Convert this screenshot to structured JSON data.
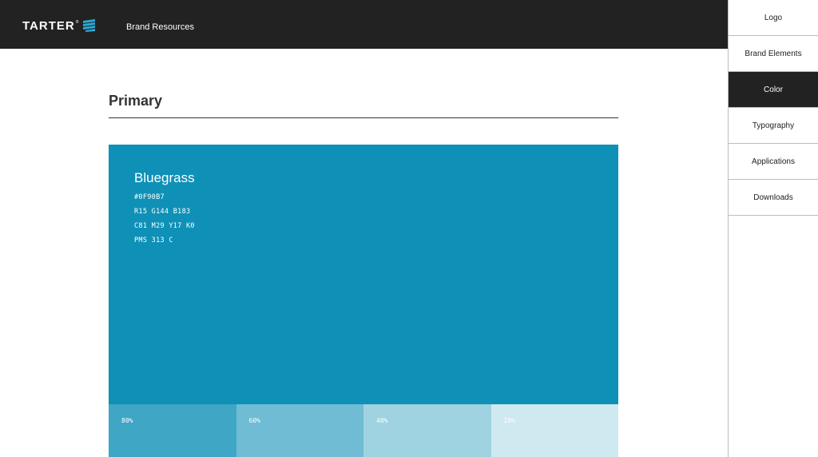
{
  "header": {
    "logo_text": "TARTER",
    "logo_reg": "®",
    "nav_label": "Brand Resources",
    "background": "#222222"
  },
  "sidebar": {
    "items": [
      {
        "label": "Logo",
        "active": false
      },
      {
        "label": "Brand Elements",
        "active": false
      },
      {
        "label": "Color",
        "active": true
      },
      {
        "label": "Typography",
        "active": false
      },
      {
        "label": "Applications",
        "active": false
      },
      {
        "label": "Downloads",
        "active": false
      }
    ]
  },
  "main": {
    "section_title": "Primary",
    "swatch": {
      "name": "Bluegrass",
      "hex": "#0F90B7",
      "rgb": "R15 G144 B183",
      "cmyk": "C81 M29 Y17 K0",
      "pms": "PMS 313 C",
      "color": "#0F90B7"
    },
    "tints": [
      {
        "label": "80%",
        "color": "#3FA6C5"
      },
      {
        "label": "60%",
        "color": "#6FBCD4"
      },
      {
        "label": "40%",
        "color": "#9FD3E2"
      },
      {
        "label": "20%",
        "color": "#CFE9F1"
      }
    ]
  },
  "icons": {
    "logo_mark": "tarter-wave-mark-icon"
  }
}
